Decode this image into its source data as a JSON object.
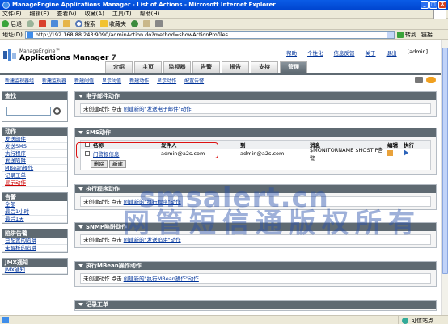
{
  "window": {
    "title": "ManageEngine Applications Manager - List of Actions - Microsoft Internet Explorer",
    "buttons": [
      "_",
      "□",
      "X"
    ]
  },
  "menubar": {
    "items": [
      "文件(F)",
      "编辑(E)",
      "查看(V)",
      "收藏(A)",
      "工具(T)",
      "帮助(H)"
    ]
  },
  "toolbar": {
    "back": "后退",
    "search": "搜索",
    "favorites": "收藏夹"
  },
  "addressbar": {
    "label": "地址(D)",
    "url": "http://192.168.88.243:9090/adminAction.do?method=showActionProfiles",
    "go": "转到",
    "links": "链接"
  },
  "brand": {
    "small": "ManageEngine™",
    "name": "Applications Manager",
    "version": "7"
  },
  "toplinks": [
    "帮助",
    "个性化",
    "信息反馈",
    "关于",
    "退出"
  ],
  "user": "[admin]",
  "tabs": [
    {
      "label": "介绍",
      "active": false
    },
    {
      "label": "主页",
      "active": false
    },
    {
      "label": "监视器",
      "active": false
    },
    {
      "label": "告警",
      "active": false
    },
    {
      "label": "报告",
      "active": false
    },
    {
      "label": "支持",
      "active": false
    },
    {
      "label": "管理",
      "active": true
    }
  ],
  "subnav": [
    "新建监视器组",
    "新建监视器",
    "新建阈值",
    "显示阈值",
    "新建动作",
    "显示动作",
    "配置告警"
  ],
  "sidebar": {
    "search": {
      "title": "查找"
    },
    "actions": {
      "title": "动作",
      "items": [
        "发送邮件",
        "发送SMS",
        "执行程序",
        "发送陷阱",
        "MBean操作",
        "记录工单",
        "显示动作"
      ]
    },
    "alarms": {
      "title": "告警",
      "items": [
        "全部",
        "最后1小时",
        "最后1天"
      ]
    },
    "trap_alarms": {
      "title": "陷阱告警",
      "items": [
        "已配置的陷阱",
        "未解析的陷阱"
      ]
    },
    "jmx": {
      "title": "JMX通知",
      "items": [
        "JMX通知"
      ]
    }
  },
  "panels": {
    "email": {
      "title": "电子邮件动作",
      "text": "未创建动作 点击",
      "link": "创建新的\"发送电子邮件\"动作"
    },
    "sms": {
      "title": "SMS动作",
      "columns": [
        "名称",
        "发件人",
        "到",
        "消息",
        "编辑",
        "执行"
      ],
      "rows": [
        {
          "name": "门警报信息",
          "from": "admin@a2s.com",
          "to": "admin@a2s.com",
          "message": "$MONITORNAME $HOSTIP告警"
        }
      ],
      "buttons": [
        "删除",
        "新建"
      ]
    },
    "program": {
      "title": "执行程序动作",
      "text": "未创建动作 点击",
      "link": "创建新的\"执行程序\"动作"
    },
    "snmp": {
      "title": "SNMP陷阱动作",
      "text": "未创建动作 点击",
      "link": "创建新的\"发送陷阱\"动作"
    },
    "mbean": {
      "title": "执行MBean操作动作",
      "text": "未创建动作 点击",
      "link": "创建新的\"执行MBean操作\"动作"
    },
    "ticket": {
      "title": "记录工单"
    }
  },
  "watermark": {
    "line1": "smsalert.cn",
    "line2": "网管短信通版权所有"
  },
  "statusbar": {
    "zone": "可信站点"
  }
}
